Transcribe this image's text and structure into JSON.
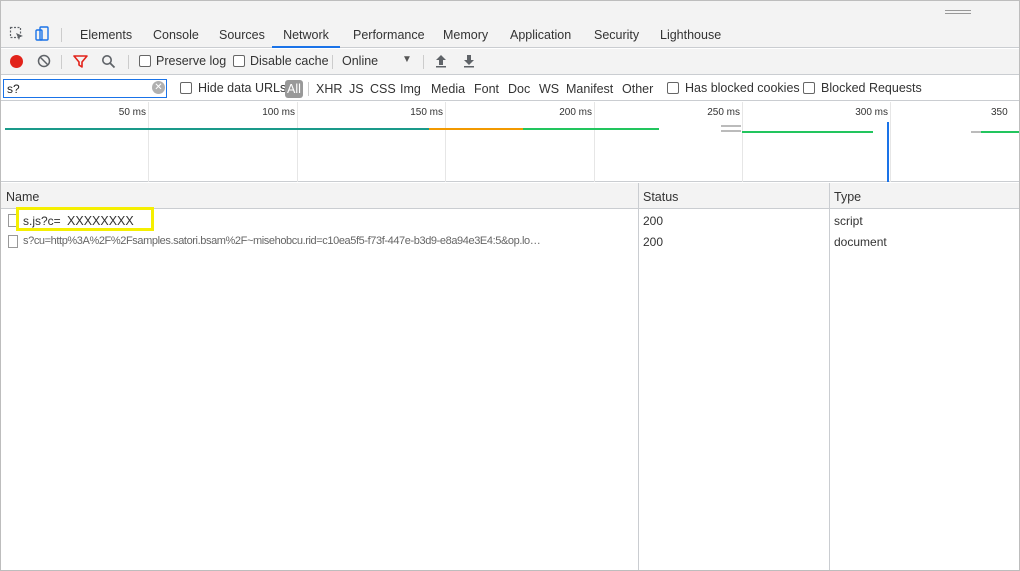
{
  "tabs": [
    "Elements",
    "Console",
    "Sources",
    "Network",
    "Performance",
    "Memory",
    "Application",
    "Security",
    "Lighthouse"
  ],
  "active_tab": "Network",
  "toolbar": {
    "preserve_log": "Preserve log",
    "disable_cache": "Disable cache",
    "throttle": "Online"
  },
  "filter": {
    "value": "s?",
    "hide_data_urls": "Hide data URLs",
    "types": [
      "All",
      "XHR",
      "JS",
      "CSS",
      "Img",
      "Media",
      "Font",
      "Doc",
      "WS",
      "Manifest",
      "Other"
    ],
    "has_blocked_cookies": "Has blocked cookies",
    "blocked_requests": "Blocked Requests"
  },
  "timeline": {
    "ticks": [
      "50 ms",
      "100 ms",
      "150 ms",
      "200 ms",
      "250 ms",
      "300 ms",
      "350"
    ],
    "colors": {
      "waiting": "#1a9a8a",
      "blocked": "#f29900",
      "receiving": "#22c55e",
      "marker": "#1a73e8"
    }
  },
  "table": {
    "headers": {
      "name": "Name",
      "status": "Status",
      "type": "Type"
    },
    "rows": [
      {
        "name": "s.js?c=",
        "redacted": "XXXXXXXX",
        "status": "200",
        "type": "script"
      },
      {
        "name": "s?cu=http%3A%2F%2Fsamples.satori.bsam%2F~misehobcu.rid=c10ea5f5-f73f-447e-b3d9-e8a94e3E4:5&op.lo…",
        "status": "200",
        "type": "document"
      }
    ]
  }
}
